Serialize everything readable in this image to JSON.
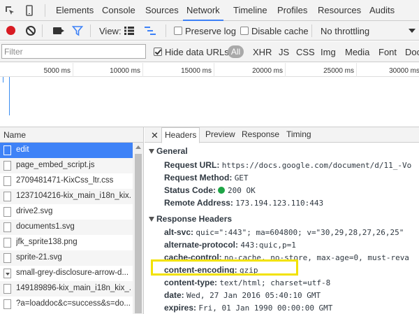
{
  "tabbar": {
    "icons": [
      "inspect-element-icon",
      "device-mode-icon"
    ],
    "tabs": [
      "Elements",
      "Console",
      "Sources",
      "Network",
      "Timeline",
      "Profiles",
      "Resources",
      "Audits"
    ],
    "active_tab": "Network"
  },
  "toolbar": {
    "view_label": "View:",
    "preserve_log": "Preserve log",
    "disable_cache": "Disable cache",
    "throttling": "No throttling"
  },
  "filter": {
    "placeholder": "Filter",
    "hide_data_urls": "Hide data URLs",
    "types": [
      "All",
      "XHR",
      "JS",
      "CSS",
      "Img",
      "Media",
      "Font",
      "Doc"
    ]
  },
  "ruler": {
    "ticks": [
      "5000 ms",
      "10000 ms",
      "15000 ms",
      "20000 ms",
      "25000 ms",
      "30000 ms"
    ]
  },
  "requests": {
    "header": "Name",
    "items": [
      "edit",
      "page_embed_script.js",
      "2709481471-KixCss_ltr.css",
      "1237104216-kix_main_i18n_kix...",
      "drive2.svg",
      "documents1.svg",
      "jfk_sprite138.png",
      "sprite-21.svg",
      "small-grey-disclosure-arrow-d...",
      "149189896-kix_main_i18n_kix_...",
      "?a=loaddoc&c=success&s=do..."
    ]
  },
  "detail": {
    "close": "✕",
    "tabs": [
      "Headers",
      "Preview",
      "Response",
      "Timing"
    ],
    "general": {
      "title": "General",
      "rows": [
        {
          "k": "Request URL:",
          "v": "https://docs.google.com/document/d/11_-Vo"
        },
        {
          "k": "Request Method:",
          "v": "GET"
        },
        {
          "k": "Status Code:",
          "v": "200 OK"
        },
        {
          "k": "Remote Address:",
          "v": "173.194.123.110:443"
        }
      ]
    },
    "response": {
      "title": "Response Headers",
      "rows": [
        {
          "k": "alt-svc:",
          "v": "quic=\":443\"; ma=604800; v=\"30,29,28,27,26,25\""
        },
        {
          "k": "alternate-protocol:",
          "v": "443:quic,p=1"
        },
        {
          "k": "cache-control:",
          "v": "no-cache, no-store, max-age=0, must-reva"
        },
        {
          "k": "content-encoding:",
          "v": "gzip"
        },
        {
          "k": "content-type:",
          "v": "text/html; charset=utf-8"
        },
        {
          "k": "date:",
          "v": "Wed, 27 Jan 2016 05:40:10 GMT"
        },
        {
          "k": "expires:",
          "v": "Fri, 01 Jan 1990 00:00:00 GMT"
        }
      ]
    },
    "status_color": "#1ea446",
    "highlight_color": "#f2e200"
  }
}
